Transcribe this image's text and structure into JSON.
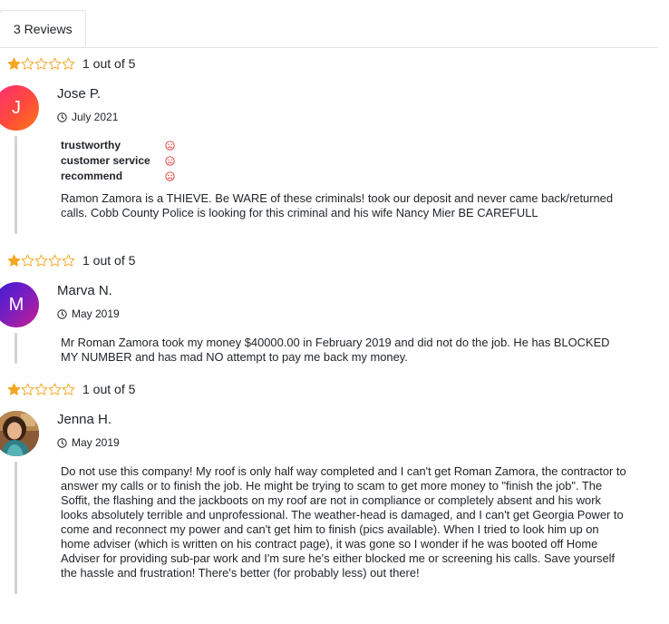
{
  "tab": {
    "label": "3 Reviews"
  },
  "reviews": [
    {
      "rating": 1,
      "rating_text": "1 out of 5",
      "initial": "J",
      "name": "Jose P.",
      "date": "July 2021",
      "attributes": [
        {
          "label": "trustworthy",
          "icon": "frown-icon"
        },
        {
          "label": "customer service",
          "icon": "frown-icon"
        },
        {
          "label": "recommend",
          "icon": "frown-icon"
        }
      ],
      "text": "Ramon Zamora is a THIEVE. Be WARE of these criminals! took our deposit and never came back/returned calls. Cobb County Police is looking for this criminal and his wife Nancy Mier BE CAREFULL"
    },
    {
      "rating": 1,
      "rating_text": "1 out of 5",
      "initial": "M",
      "name": "Marva N.",
      "date": "May 2019",
      "text": "Mr Roman Zamora took my money $40000.00 in February 2019 and did not do the job. He has BLOCKED MY NUMBER and has mad NO attempt to pay me back my money."
    },
    {
      "rating": 1,
      "rating_text": "1 out of 5",
      "name": "Jenna H.",
      "date": "May 2019",
      "text": "Do not use this company! My roof is only half way completed and I can't get Roman Zamora, the contractor to answer my calls or to finish the job. He might be trying to scam to get more money to \"finish the job\". The Soffit, the flashing and the jackboots on my roof are not in compliance or completely absent and his work looks absolutely terrible and unprofessional. The weather-head is damaged, and I can't get Georgia Power to come and reconnect my power and can't get him to finish (pics available). When I tried to look him up on home adviser (which is written on his contract page), it was gone so I wonder if he was booted off Home Adviser for providing sub-par work and I'm sure he's either blocked me or screening his calls. Save yourself the hassle and frustration! There's better (for probably less) out there!"
    }
  ],
  "colors": {
    "star": "#f5a623",
    "frown": "#e53935",
    "accent_line": "#d0d3d8"
  }
}
